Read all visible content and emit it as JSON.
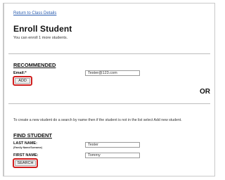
{
  "nav": {
    "back_link": "Return to Class Details"
  },
  "header": {
    "title": "Enroll Student",
    "subtitle": "You can enroll 1 more students."
  },
  "recommended": {
    "heading": "RECOMMENDED",
    "email_label": "Email:*",
    "email_value": "Tester@123.com",
    "add_button": "ADD"
  },
  "divider_text": "OR",
  "info_text": "To create a new student do a search by name then if the student is not in the list select Add new student.",
  "find": {
    "heading": "FIND STUDENT",
    "last_name_label": "LAST NAME:",
    "last_name_hint": "(Family Name/Surname)",
    "last_name_value": "Tester",
    "first_name_label": "FIRST NAME:",
    "first_name_value": "Tommy",
    "search_button": "SEARCH"
  },
  "colors": {
    "highlight": "#d01f1f",
    "link": "#2a5db0"
  }
}
